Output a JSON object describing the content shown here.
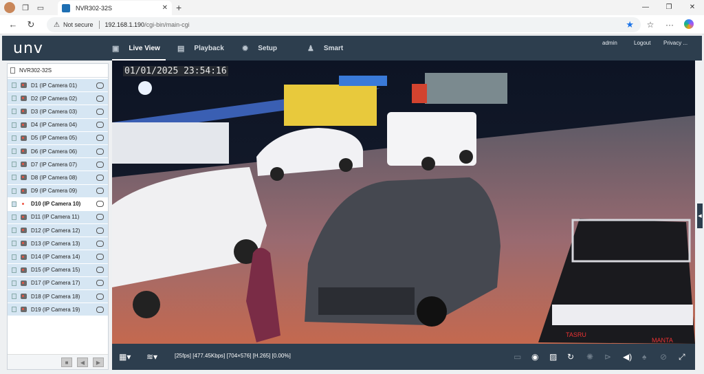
{
  "browser": {
    "tab_title": "NVR302-32S",
    "security_label": "Not secure",
    "url_host": "192.168.1.190",
    "url_path": "/cgi-bin/main-cgi"
  },
  "app": {
    "logo": "unv",
    "nav": [
      {
        "label": "Live View",
        "icon": "live-view-icon",
        "active": true
      },
      {
        "label": "Playback",
        "icon": "playback-icon"
      },
      {
        "label": "Setup",
        "icon": "gear-icon"
      },
      {
        "label": "Smart",
        "icon": "smart-icon"
      }
    ],
    "user": "admin",
    "logout": "Logout",
    "privacy": "Privacy ..."
  },
  "sidebar": {
    "device": "NVR302-32S",
    "cameras": [
      "D1 (IP Camera 01)",
      "D2 (IP Camera 02)",
      "D3 (IP Camera 03)",
      "D4 (IP Camera 04)",
      "D5 (IP Camera 05)",
      "D6 (IP Camera 06)",
      "D7 (IP Camera 07)",
      "D8 (IP Camera 08)",
      "D9 (IP Camera 09)",
      "D10 (IP Camera 10)",
      "D11 (IP Camera 11)",
      "D12 (IP Camera 12)",
      "D13 (IP Camera 13)",
      "D14 (IP Camera 14)",
      "D15 (IP Camera 15)",
      "D17 (IP Camera 17)",
      "D18 (IP Camera 18)",
      "D19 (IP Camera 19)"
    ],
    "selected_camera": "D10 (IP Camera 10)"
  },
  "video": {
    "osd_timestamp": "01/01/2025 23:54:16",
    "signs": [
      "TASRU",
      "MANTA"
    ]
  },
  "toolbar": {
    "stream_info": "[25fps] [477.45Kbps] [704×576] [H.265] [0.00%]"
  },
  "colors": {
    "header": "#2d3e4e",
    "camera_row": "#d6e6f3",
    "accent": "#1a73e8"
  }
}
